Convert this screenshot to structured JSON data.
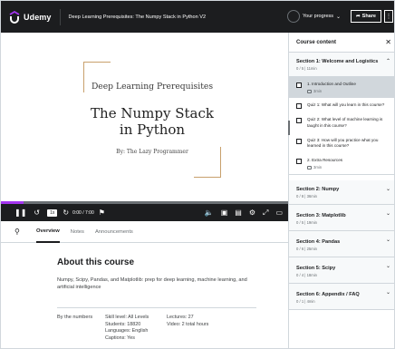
{
  "header": {
    "logo_text": "Udemy",
    "course_title": "Deep Learning Prerequisites: The Numpy Stack in Python V2",
    "progress_label": "Your progress",
    "share_label": "Share",
    "more_label": "⋮"
  },
  "video": {
    "slide_kicker": "Deep Learning Prerequisites",
    "slide_title_line1": "The Numpy Stack",
    "slide_title_line2": "in Python",
    "slide_author": "By: The Lazy Programmer",
    "progress_fraction": 0.08,
    "speed": "1x",
    "time": "0:00 / 7:00"
  },
  "tabs": [
    {
      "label": "Overview",
      "active": true
    },
    {
      "label": "Notes",
      "active": false
    },
    {
      "label": "Announcements",
      "active": false
    }
  ],
  "about": {
    "title": "About this course",
    "description": "Numpy, Scipy, Pandas, and Matplotlib: prep for deep learning, machine learning, and artificial intelligence",
    "stats_label": "By the numbers",
    "col1": [
      "Skill level: All Levels",
      "Students: 18820",
      "Languages: English",
      "Captions: Yes"
    ],
    "col2": [
      "Lectures: 27",
      "Video: 2 total hours"
    ]
  },
  "sidebar": {
    "title": "Course content",
    "close": "✕",
    "sections": [
      {
        "title": "Section 1: Welcome and Logistics",
        "meta": "0 / 5 | 11min",
        "expanded": true,
        "lessons": [
          {
            "title": "1. Introduction and Outline",
            "duration": "3min",
            "current": true
          },
          {
            "title": "Quiz 1: What will you learn in this course?",
            "duration": ""
          },
          {
            "title": "Quiz 2: What level of machine learning is taught in this course?",
            "duration": ""
          },
          {
            "title": "Quiz 3: How will you practice what you learned in this course?",
            "duration": ""
          },
          {
            "title": "2. Extra Resources",
            "duration": "3min"
          }
        ]
      },
      {
        "title": "Section 2: Numpy",
        "meta": "0 / 8 | 36min"
      },
      {
        "title": "Section 3: Matplotlib",
        "meta": "0 / 5 | 19min"
      },
      {
        "title": "Section 4: Pandas",
        "meta": "0 / 6 | 25min"
      },
      {
        "title": "Section 5: Scipy",
        "meta": "0 / 4 | 18min"
      },
      {
        "title": "Section 6: Appendix / FAQ",
        "meta": "0 / 1 | 4min"
      }
    ]
  },
  "colors": {
    "brand": "#a435f0",
    "header_bg": "#1c1d1f",
    "slide_accent": "#c8a06c"
  }
}
